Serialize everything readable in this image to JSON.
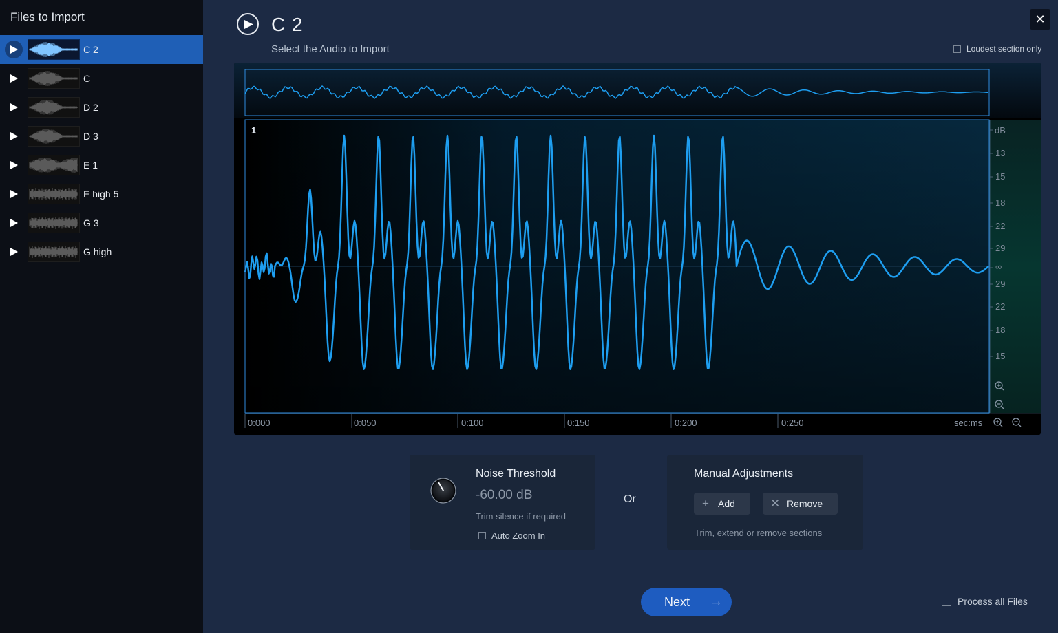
{
  "sidebar": {
    "title": "Files to Import",
    "items": [
      {
        "label": "C 2",
        "selected": true
      },
      {
        "label": "C",
        "selected": false
      },
      {
        "label": "D 2",
        "selected": false
      },
      {
        "label": "D 3",
        "selected": false
      },
      {
        "label": "E 1",
        "selected": false
      },
      {
        "label": "E high 5",
        "selected": false
      },
      {
        "label": "G 3",
        "selected": false
      },
      {
        "label": "G high",
        "selected": false
      }
    ]
  },
  "header": {
    "title": "C 2",
    "subtitle": "Select the Audio to Import",
    "loudest_label": "Loudest section only",
    "close_icon": "close-icon"
  },
  "waveform": {
    "section_number": "1",
    "db_labels": [
      "dB",
      "13",
      "15",
      "18",
      "22",
      "29",
      "∞",
      "29",
      "22",
      "18",
      "15"
    ],
    "time_labels": [
      "0:000",
      "0:050",
      "0:100",
      "0:150",
      "0:200",
      "0:250"
    ],
    "time_unit": "sec:ms",
    "wave_color": "#1e9ef0",
    "selection_color": "#2f8ce0"
  },
  "noise": {
    "title": "Noise Threshold",
    "value": "-60.00 dB",
    "hint": "Trim silence if required",
    "auto_zoom_label": "Auto Zoom In"
  },
  "or_label": "Or",
  "manual": {
    "title": "Manual Adjustments",
    "add_label": "Add",
    "remove_label": "Remove",
    "hint": "Trim, extend or remove sections"
  },
  "footer": {
    "next_label": "Next",
    "process_all_label": "Process all Files"
  },
  "colors": {
    "accent": "#1f5fb6",
    "background": "#1c2a44",
    "sidebar": "#0c0f16"
  }
}
